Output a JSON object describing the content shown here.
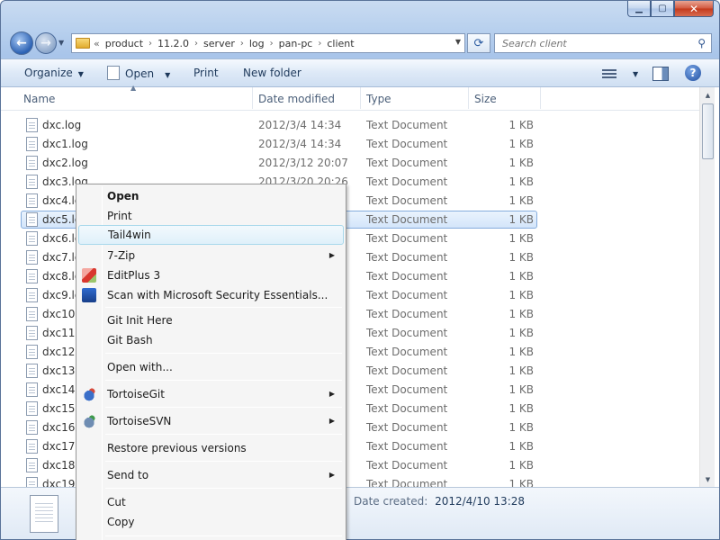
{
  "window": {
    "caption_buttons": {
      "minimize": "▁",
      "maximize": "▢",
      "close": "✕"
    }
  },
  "nav": {
    "back_glyph": "←",
    "forward_glyph": "→",
    "address_overflow": "«",
    "breadcrumbs": [
      "product",
      "11.2.0",
      "server",
      "log",
      "pan-pc",
      "client"
    ],
    "refresh_glyph": "⟳",
    "search_placeholder": "Search client"
  },
  "toolbar": {
    "organize": "Organize",
    "open": "Open",
    "print": "Print",
    "new_folder": "New folder",
    "help": "?"
  },
  "columns": {
    "name": "Name",
    "date": "Date modified",
    "type": "Type",
    "size": "Size",
    "sort_glyph": "▲"
  },
  "files": [
    {
      "name": "dxc.log",
      "date": "2012/3/4 14:34",
      "type": "Text Document",
      "size": "1 KB"
    },
    {
      "name": "dxc1.log",
      "date": "2012/3/4 14:34",
      "type": "Text Document",
      "size": "1 KB"
    },
    {
      "name": "dxc2.log",
      "date": "2012/3/12 20:07",
      "type": "Text Document",
      "size": "1 KB"
    },
    {
      "name": "dxc3.log",
      "date": "2012/3/20 20:26",
      "type": "Text Document",
      "size": "1 KB"
    },
    {
      "name": "dxc4.lo",
      "date": "",
      "type": "Text Document",
      "size": "1 KB"
    },
    {
      "name": "dxc5.lo",
      "date": "",
      "type": "Text Document",
      "size": "1 KB",
      "selected": true
    },
    {
      "name": "dxc6.lo",
      "date": "",
      "type": "Text Document",
      "size": "1 KB"
    },
    {
      "name": "dxc7.lo",
      "date": "",
      "type": "Text Document",
      "size": "1 KB"
    },
    {
      "name": "dxc8.lo",
      "date": "",
      "type": "Text Document",
      "size": "1 KB"
    },
    {
      "name": "dxc9.lo",
      "date": "",
      "type": "Text Document",
      "size": "1 KB"
    },
    {
      "name": "dxc10.l",
      "date": "",
      "type": "Text Document",
      "size": "1 KB"
    },
    {
      "name": "dxc11.l",
      "date": "",
      "type": "Text Document",
      "size": "1 KB"
    },
    {
      "name": "dxc12.l",
      "date": "",
      "type": "Text Document",
      "size": "1 KB"
    },
    {
      "name": "dxc13.l",
      "date": "",
      "type": "Text Document",
      "size": "1 KB"
    },
    {
      "name": "dxc14.l",
      "date": "",
      "type": "Text Document",
      "size": "1 KB"
    },
    {
      "name": "dxc15.l",
      "date": "",
      "type": "Text Document",
      "size": "1 KB"
    },
    {
      "name": "dxc16.l",
      "date": "",
      "type": "Text Document",
      "size": "1 KB"
    },
    {
      "name": "dxc17.l",
      "date": "",
      "type": "Text Document",
      "size": "1 KB"
    },
    {
      "name": "dxc18.l",
      "date": "",
      "type": "Text Document",
      "size": "1 KB"
    },
    {
      "name": "dxc19.l",
      "date": "",
      "type": "Text Document",
      "size": "1 KB"
    }
  ],
  "details": {
    "date_created_label": "Date created:",
    "date_created_value": "2012/4/10 13:28"
  },
  "context_menu": {
    "open": "Open",
    "print": "Print",
    "tail4win": "Tail4win",
    "sevenzip": "7-Zip",
    "editplus": "EditPlus 3",
    "scan": "Scan with Microsoft Security Essentials...",
    "git_init": "Git Init Here",
    "git_bash": "Git Bash",
    "open_with": "Open with...",
    "tortoisegit": "TortoiseGit",
    "tortoisesvn": "TortoiseSVN",
    "restore": "Restore previous versions",
    "send_to": "Send to",
    "cut": "Cut",
    "copy": "Copy"
  }
}
